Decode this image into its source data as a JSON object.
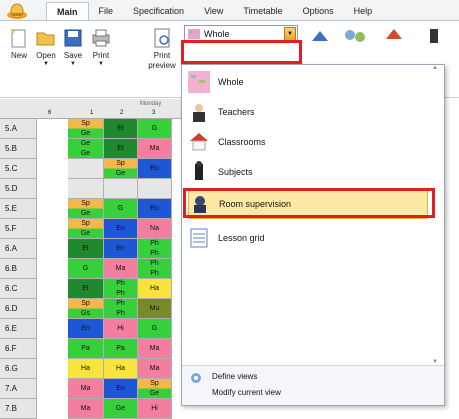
{
  "menu_tabs": [
    "Main",
    "File",
    "Specification",
    "View",
    "Timetable",
    "Options",
    "Help"
  ],
  "ribbon": {
    "buttons": [
      {
        "label": "New",
        "icon": "new-icon",
        "dropdown": false
      },
      {
        "label": "Open",
        "icon": "open-icon",
        "dropdown": true
      },
      {
        "label": "Save",
        "icon": "save-icon",
        "dropdown": true
      },
      {
        "label": "Print",
        "icon": "print-icon",
        "dropdown": true
      },
      {
        "label": "Print preview",
        "icon": "print-preview-icon",
        "dropdown": false
      }
    ],
    "view_combo": {
      "value": "Whole"
    }
  },
  "grid": {
    "header_day": "Monday",
    "periods": [
      "6",
      "1",
      "2",
      "3"
    ],
    "rows": [
      {
        "label": "5.A",
        "cells": [
          [
            "Sp",
            "Ge"
          ],
          [
            "Et"
          ],
          [
            "G"
          ]
        ]
      },
      {
        "label": "5.B",
        "cells": [
          [
            "Ge",
            "Ge"
          ],
          [
            "Et"
          ],
          [
            "Ma"
          ]
        ]
      },
      {
        "label": "5.C",
        "cells": [
          [
            ""
          ],
          [
            "Sp",
            "Ge"
          ],
          [
            "En"
          ]
        ]
      },
      {
        "label": "5.D",
        "cells": [
          [
            ""
          ],
          [
            ""
          ],
          [
            ""
          ]
        ]
      },
      {
        "label": "5.E",
        "cells": [
          [
            "Sp",
            "Ge"
          ],
          [
            "G"
          ],
          [
            "En"
          ]
        ]
      },
      {
        "label": "5.F",
        "cells": [
          [
            "Sp",
            "Ge"
          ],
          [
            "En"
          ],
          [
            "Na"
          ]
        ]
      },
      {
        "label": "6.A",
        "cells": [
          [
            "Et"
          ],
          [
            "En"
          ],
          [
            "Ph",
            "Ph"
          ]
        ]
      },
      {
        "label": "6.B",
        "cells": [
          [
            "G"
          ],
          [
            "Ma"
          ],
          [
            "Ph",
            "Ph"
          ]
        ]
      },
      {
        "label": "6.C",
        "cells": [
          [
            "Et"
          ],
          [
            "Ph",
            "Ph"
          ],
          [
            "Ha"
          ]
        ]
      },
      {
        "label": "6.D",
        "cells": [
          [
            "Sp",
            "Gs"
          ],
          [
            "Ph",
            "Ph"
          ],
          [
            "Mu"
          ]
        ]
      },
      {
        "label": "6.E",
        "cells": [
          [
            "En"
          ],
          [
            "Hi"
          ],
          [
            "G"
          ]
        ]
      },
      {
        "label": "6.F",
        "cells": [
          [
            "Pa"
          ],
          [
            "Pa"
          ],
          [
            "Ma"
          ]
        ]
      },
      {
        "label": "6.G",
        "cells": [
          [
            "Ha"
          ],
          [
            "Ha"
          ],
          [
            "Ma"
          ]
        ]
      },
      {
        "label": "7.A",
        "cells": [
          [
            "Ma"
          ],
          [
            "En"
          ],
          [
            "Sp",
            "Ge"
          ]
        ]
      },
      {
        "label": "7.B",
        "cells": [
          [
            "Ma"
          ],
          [
            "Ge"
          ],
          [
            "Hi"
          ]
        ]
      }
    ]
  },
  "dropdown": {
    "items": [
      {
        "label": "Whole",
        "icon": "whole-grid-icon",
        "selected": false
      },
      {
        "label": "Teachers",
        "icon": "teacher-icon",
        "selected": false
      },
      {
        "label": "Classrooms",
        "icon": "classroom-icon",
        "selected": false
      },
      {
        "label": "Subjects",
        "icon": "subjects-icon",
        "selected": false
      },
      {
        "label": "Room supervision",
        "icon": "room-supervision-icon",
        "selected": true
      },
      {
        "label": "Lesson grid",
        "icon": "lesson-grid-icon",
        "selected": false
      }
    ],
    "footer": [
      {
        "label": "Define views",
        "icon": "define-views-icon"
      },
      {
        "label": "Modify current view"
      }
    ]
  },
  "colors": {
    "accent": "#e02020",
    "selected_bg": "#fde9a6",
    "cell_orange": "#f5b64a",
    "cell_green": "#35d03a",
    "cell_darkgreen": "#1f8a2d",
    "cell_blue": "#1d57d8",
    "cell_purple": "#8b47c8",
    "cell_pink": "#f37ea0",
    "cell_lime": "#b9f07a",
    "cell_yellow": "#f8e43a",
    "cell_olive": "#7a8a2a",
    "cell_brown": "#8b5a24",
    "cell_red": "#e52020"
  }
}
